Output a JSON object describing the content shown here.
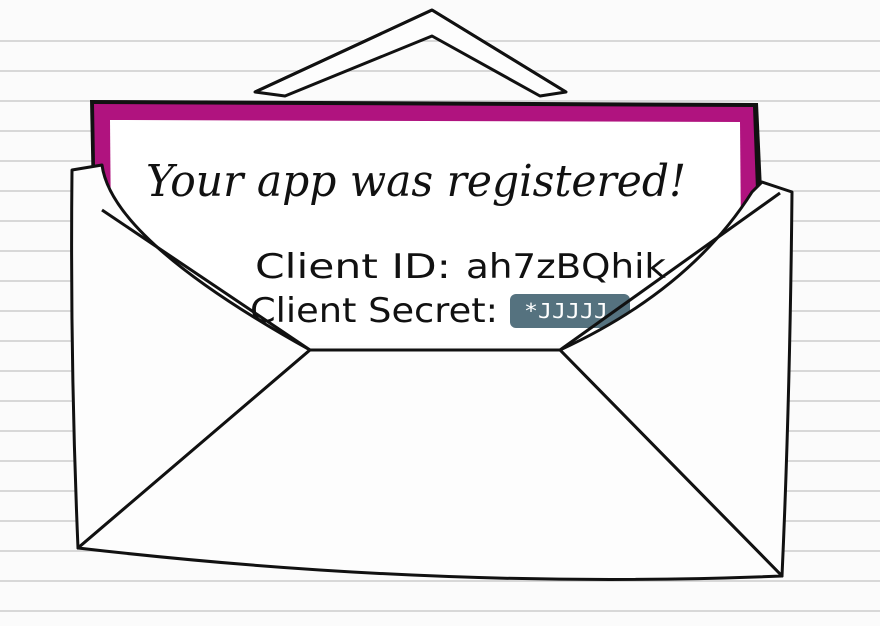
{
  "letter": {
    "title": "Your app  was registered!",
    "client_id_label": "Client ID:",
    "client_id_value": "ah7zBQhik",
    "client_secret_label": "Client Secret:",
    "client_secret_value": "*JJJJJ"
  },
  "colors": {
    "paper": "#fbfbfb",
    "ruled_line": "#d8d8d8",
    "letter_border": "#b0137f",
    "ink": "#111111",
    "secret_box": "#55727f"
  },
  "icons": {
    "envelope": "envelope-icon",
    "redacted_secret": "redacted-block"
  }
}
